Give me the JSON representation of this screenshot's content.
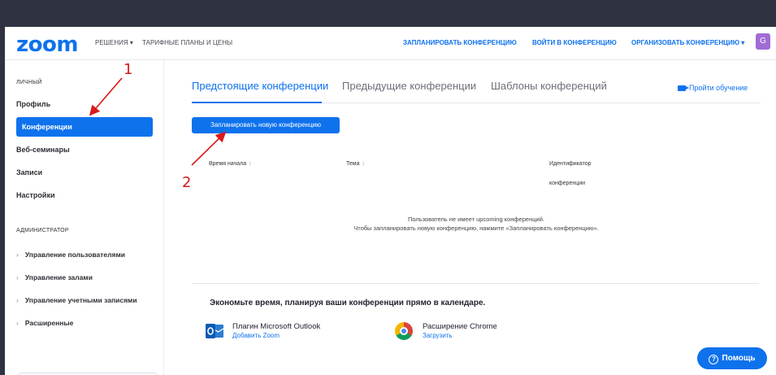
{
  "navbar": {
    "logo": "zoom",
    "solutions": "РЕШЕНИЯ ▾",
    "plans": "ТАРИФНЫЕ ПЛАНЫ И ЦЕНЫ",
    "schedule": "ЗАПЛАНИРОВАТЬ КОНФЕРЕНЦИЮ",
    "join": "ВОЙТИ В КОНФЕРЕНЦИЮ",
    "host": "ОРГАНИЗОВАТЬ КОНФЕРЕНЦИЮ ▾",
    "avatar": "G"
  },
  "sidebar": {
    "personal_heading": "ЛИЧНЫЙ",
    "items": [
      {
        "label": "Профиль"
      },
      {
        "label": "Конференции"
      },
      {
        "label": "Веб-семинары"
      },
      {
        "label": "Записи"
      },
      {
        "label": "Настройки"
      }
    ],
    "admin_heading": "АДМИНИСТРАТОР",
    "admin_items": [
      {
        "label": "Управление пользователями"
      },
      {
        "label": "Управление залами"
      },
      {
        "label": "Управление учетными записями"
      },
      {
        "label": "Расширенные"
      }
    ]
  },
  "tabs": [
    {
      "label": "Предстоящие конференции"
    },
    {
      "label": "Предыдущие конференции"
    },
    {
      "label": "Шаблоны конференций"
    }
  ],
  "training_link": "Пройти обучение",
  "schedule_button": "Запланировать новую конференцию",
  "table": {
    "columns": [
      "Время начала",
      "Тема",
      "Идентификатор",
      "конференции"
    ],
    "sort_glyph": "↕"
  },
  "empty_state": {
    "line1": "Пользователь не имеет upcoming конференций.",
    "line2": "Чтобы запланировать новую конференцию, нажмите «Запланировать конференцию»."
  },
  "promo": {
    "title": "Экономьте время, планируя ваши конференции прямо в календаре.",
    "outlook_name": "Плагин Microsoft Outlook",
    "outlook_link": "Добавить Zoom",
    "chrome_name": "Расширение Chrome",
    "chrome_link": "Загрузить"
  },
  "help_button": "Помощь",
  "annotations": {
    "one": "1",
    "two": "2"
  },
  "colors": {
    "accent": "#0e72ed",
    "annotation": "#d91a1a"
  }
}
